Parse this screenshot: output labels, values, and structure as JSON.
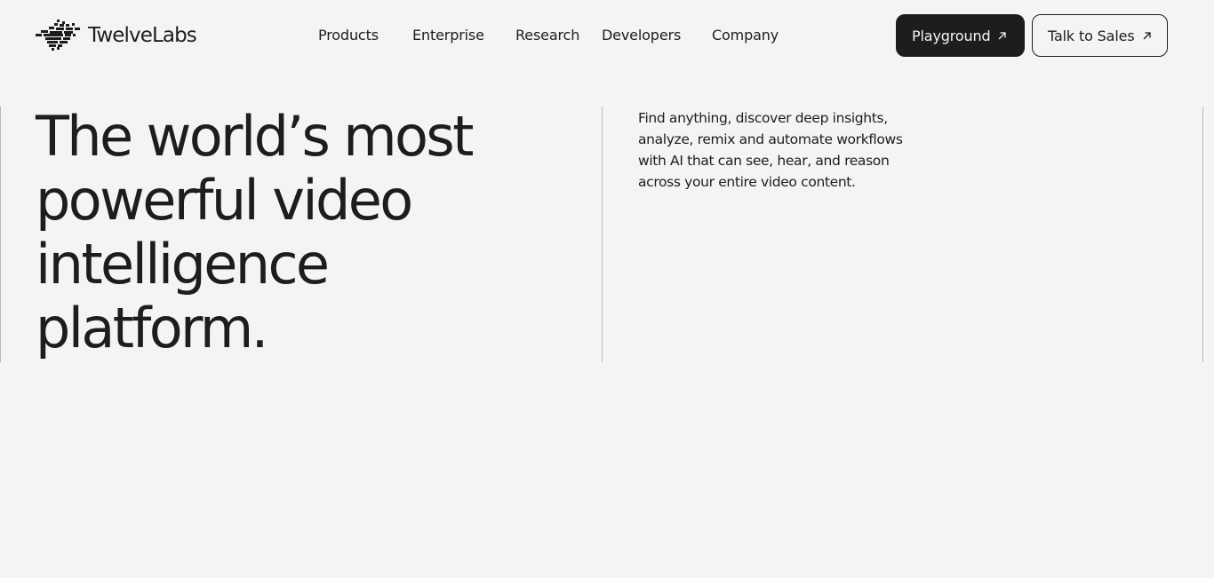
{
  "brand": {
    "name": "TwelveLabs",
    "logo_icon": "twelvelabs-mark-icon"
  },
  "nav": {
    "items": [
      {
        "label": "Products"
      },
      {
        "label": "Enterprise"
      },
      {
        "label": "Research"
      },
      {
        "label": "Developers"
      },
      {
        "label": "Company"
      }
    ]
  },
  "actions": {
    "playground_label": "Playground",
    "sales_label": "Talk to Sales",
    "external_icon": "arrow-up-right-icon"
  },
  "hero": {
    "title_lines": [
      "The world’s most",
      "powerful video",
      "intelligence",
      "platform."
    ],
    "description_lines": [
      "Find anything, discover deep insights,",
      "analyze, remix and automate workflows",
      "with AI that can see, hear, and reason",
      "across your entire video content."
    ]
  },
  "colors": {
    "background": "#f4f4f4",
    "text": "#1d1d1d",
    "primary_button": "#1d1d1d",
    "divider": "#b9b9b9"
  }
}
